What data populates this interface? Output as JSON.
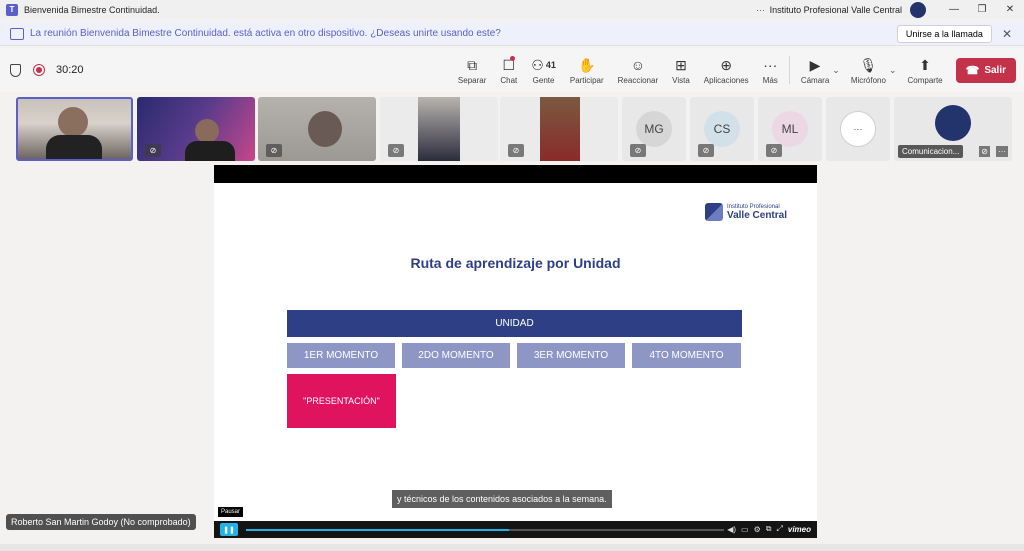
{
  "window": {
    "title": "Bienvenida Bimestre Continuidad.",
    "more": "···",
    "org": "Instituto Profesional Valle Central",
    "min": "—",
    "restore": "❐",
    "close": "✕"
  },
  "banner": {
    "text": "La reunión Bienvenida Bimestre Continuidad. está activa en otro dispositivo. ¿Deseas unirte usando este?",
    "join_button": "Unirse a la llamada",
    "close": "✕"
  },
  "toolbar": {
    "timer": "30:20",
    "items": [
      {
        "label": "Separar",
        "icon": "⧉"
      },
      {
        "label": "Chat",
        "icon": "☐"
      },
      {
        "label": "Gente",
        "icon": "⚇",
        "count": "41"
      },
      {
        "label": "Participar",
        "icon": "✋"
      },
      {
        "label": "Reaccionar",
        "icon": "☺"
      },
      {
        "label": "Vista",
        "icon": "⊞"
      },
      {
        "label": "Aplicaciones",
        "icon": "⊕"
      },
      {
        "label": "Más",
        "icon": "···"
      },
      {
        "label": "Cámara",
        "icon": "▶"
      },
      {
        "label": "Micrófono",
        "icon": "🎙"
      },
      {
        "label": "Comparte",
        "icon": "⬆"
      }
    ],
    "leave_label": "Salir",
    "chevron": "⌄"
  },
  "participants": {
    "initials": [
      "MG",
      "CS",
      "ML"
    ],
    "more": "···",
    "org_tile_label": "Comunicacion...",
    "org_tile_more": "···",
    "mic_off": "⊘"
  },
  "slide": {
    "logo_small": "Instituto Profesional",
    "logo_big": "Valle Central",
    "title": "Ruta de aprendizaje por Unidad",
    "unit": "UNIDAD",
    "moments": [
      "1ER MOMENTO",
      "2DO MOMENTO",
      "3ER MOMENTO",
      "4TO MOMENTO"
    ],
    "presentation": "\"PRESENTACIÓN\"",
    "subtitle": "y técnicos de los contenidos asociados a la semana.",
    "pause_tooltip": "Pausar",
    "pause_icon": "❚❚",
    "progress": 0.55,
    "player_icons": [
      "◀)",
      "▭",
      "⚙",
      "⧉",
      "⤢"
    ],
    "player_brand": "vimeo"
  },
  "speaker_label": "Roberto San Martin Godoy (No comprobado)",
  "colors": {
    "accent": "#5b5fc7",
    "leave": "#c4314b",
    "navy": "#2e3f86",
    "moment": "#8d96c4",
    "pink": "#e0135f"
  }
}
